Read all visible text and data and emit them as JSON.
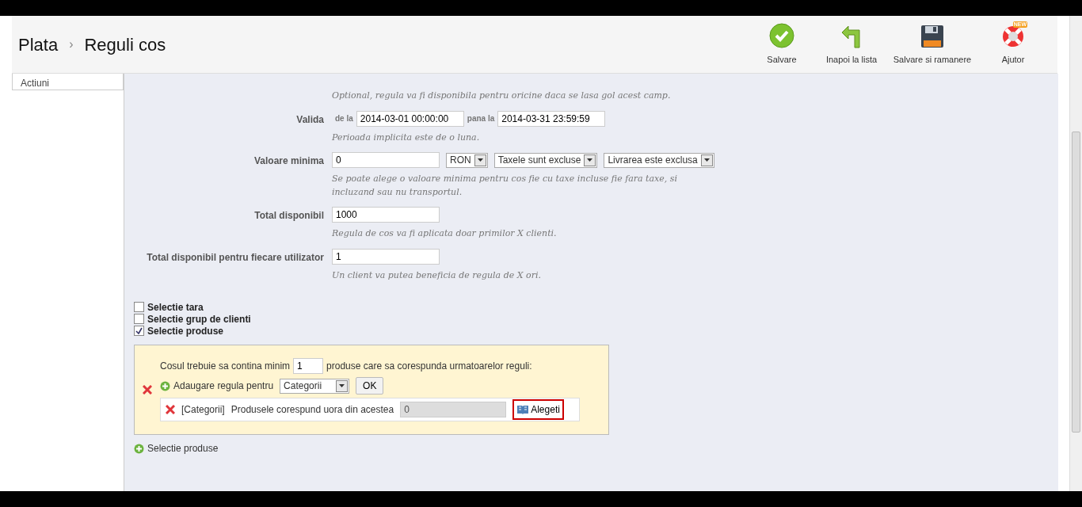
{
  "header": {
    "breadcrumb": [
      "Plata",
      "Reguli cos"
    ],
    "separator": "›",
    "toolbar": [
      {
        "kind": "save",
        "label": "Salvare"
      },
      {
        "kind": "back",
        "label": "Inapoi la lista"
      },
      {
        "kind": "disk",
        "label": "Salvare si ramanere"
      },
      {
        "kind": "help",
        "label": "Ajutor",
        "badge": "NEW"
      }
    ]
  },
  "sidebar": {
    "items": [
      {
        "label": "Actiuni"
      }
    ]
  },
  "panel": {
    "fields": [
      {
        "kind": "note",
        "hint": "Optional, regula va fi disponibila pentru oricine daca se lasa gol acest camp."
      },
      {
        "kind": "range",
        "label": "Valida",
        "from_label": "de la",
        "from": "2014-03-01 00:00:00",
        "to_label": "pana la",
        "to": "2014-03-31 23:59:59",
        "hint": "Perioada implicita este de o luna."
      },
      {
        "kind": "amount",
        "label": "Valoare minima",
        "value": "0",
        "selects": [
          "RON",
          "Taxele sunt excluse",
          "Livrarea este exclusa"
        ],
        "hint": "Se poate alege o valoare minima pentru cos fie cu taxe incluse fie fara taxe, si incluzand sau nu transportul."
      },
      {
        "kind": "text",
        "label": "Total disponibil",
        "value": "1000",
        "hint": "Regula de cos va fi aplicata doar primilor X clienti."
      },
      {
        "kind": "text",
        "label": "Total disponibil pentru fiecare utilizator",
        "value": "1",
        "hint": "Un client va putea beneficia de regula de X ori."
      }
    ],
    "checks": [
      {
        "label": "Selectie tara",
        "checked": false
      },
      {
        "label": "Selectie grup de clienti",
        "checked": false
      },
      {
        "label": "Selectie produse",
        "checked": true
      }
    ],
    "product_box": {
      "before": "Cosul trebuie sa contina minim",
      "quantity": "1",
      "after": "produse care sa corespunda urmatoarelor reguli:",
      "add_label": "Adaugare regula pentru",
      "add_select": "Categorii",
      "ok": "OK",
      "rules": [
        {
          "type": "[Categorii]",
          "text": "Produsele corespund uora din acestea",
          "value": "0",
          "choose": "Alegeti"
        }
      ]
    },
    "add_link": "Selectie produse"
  }
}
